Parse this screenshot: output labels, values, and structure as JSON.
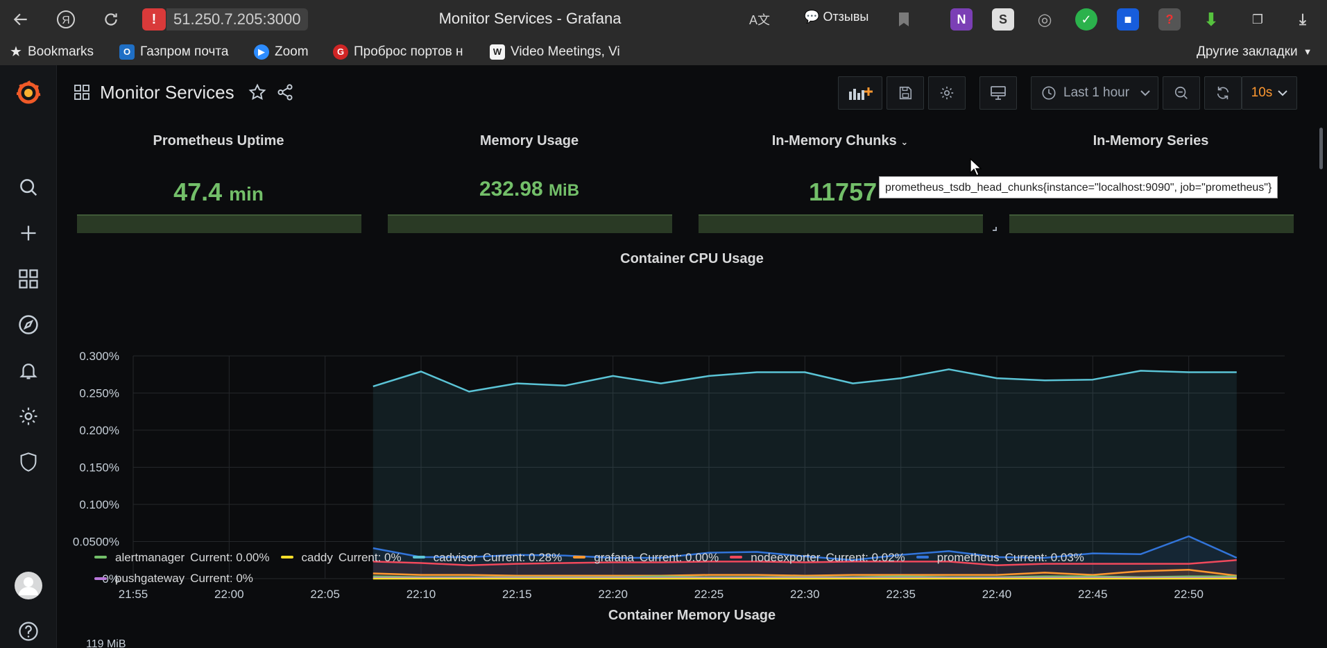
{
  "browser": {
    "address": "51.250.7.205:3000",
    "window_title": "Monitor Services - Grafana",
    "reviews_label": "Отзывы",
    "bookmarks": [
      {
        "label": "Bookmarks",
        "icon": "star-icon"
      },
      {
        "label": "Газпром почта",
        "icon": "outlook-icon"
      },
      {
        "label": "Zoom",
        "icon": "zoom-icon"
      },
      {
        "label": "Проброс портов н",
        "icon": "port-forward-icon"
      },
      {
        "label": "Video Meetings, Vi",
        "icon": "wikipedia-icon"
      }
    ],
    "other_bookmarks": "Другие закладки"
  },
  "dashboard": {
    "title": "Monitor Services",
    "time_range": "Last 1 hour",
    "refresh": "10s"
  },
  "stats": [
    {
      "title": "Prometheus Uptime",
      "value": "47.4",
      "unit": "min"
    },
    {
      "title": "Memory Usage",
      "value": "232.98",
      "unit": "MiB"
    },
    {
      "title": "In-Memory Chunks",
      "value": "11757",
      "unit": ""
    },
    {
      "title": "In-Memory Series",
      "value": "",
      "unit": ""
    }
  ],
  "tooltip": "prometheus_tsdb_head_chunks{instance=\"localhost:9090\", job=\"prometheus\"}",
  "cpu_panel": {
    "title": "Container CPU Usage"
  },
  "memory_panel": {
    "title": "Container Memory Usage",
    "first_tick": "119 MiB"
  },
  "legend": [
    {
      "name": "alertmanager",
      "current": "Current: 0.00%",
      "color": "#73bf69"
    },
    {
      "name": "caddy",
      "current": "Current: 0%",
      "color": "#fade2a"
    },
    {
      "name": "cadvisor",
      "current": "Current: 0.28%",
      "color": "#5bc4d6"
    },
    {
      "name": "grafana",
      "current": "Current: 0.00%",
      "color": "#ff9830"
    },
    {
      "name": "nodeexporter",
      "current": "Current: 0.02%",
      "color": "#f2495c"
    },
    {
      "name": "prometheus",
      "current": "Current: 0.03%",
      "color": "#3274d9"
    },
    {
      "name": "pushgateway",
      "current": "Current: 0%",
      "color": "#b877d9"
    }
  ],
  "chart_data": {
    "type": "line",
    "title": "Container CPU Usage",
    "ylim": [
      0,
      0.3
    ],
    "y_ticks": [
      "0%",
      "0.0500%",
      "0.100%",
      "0.150%",
      "0.200%",
      "0.250%",
      "0.300%"
    ],
    "x_ticks": [
      "21:55",
      "22:00",
      "22:05",
      "22:10",
      "22:15",
      "22:20",
      "22:25",
      "22:30",
      "22:35",
      "22:40",
      "22:45",
      "22:50"
    ],
    "x_range": [
      "21:55",
      "22:55"
    ],
    "x": [
      "22:07:30",
      "22:10",
      "22:12:30",
      "22:15",
      "22:17:30",
      "22:20",
      "22:22:30",
      "22:25",
      "22:27:30",
      "22:30",
      "22:32:30",
      "22:35",
      "22:37:30",
      "22:40",
      "22:42:30",
      "22:45",
      "22:47:30",
      "22:50",
      "22:52:30"
    ],
    "grid": true,
    "series": [
      {
        "name": "cadvisor",
        "color": "#5bc4d6",
        "fill": true,
        "values": [
          0.259,
          0.279,
          0.252,
          0.263,
          0.26,
          0.273,
          0.263,
          0.273,
          0.278,
          0.278,
          0.263,
          0.27,
          0.282,
          0.27,
          0.267,
          0.268,
          0.28,
          0.278,
          0.278
        ]
      },
      {
        "name": "prometheus",
        "color": "#3274d9",
        "values": [
          0.041,
          0.029,
          0.029,
          0.032,
          0.031,
          0.028,
          0.028,
          0.035,
          0.036,
          0.03,
          0.025,
          0.032,
          0.037,
          0.029,
          0.028,
          0.034,
          0.033,
          0.057,
          0.028
        ]
      },
      {
        "name": "nodeexporter",
        "color": "#f2495c",
        "values": [
          0.023,
          0.021,
          0.018,
          0.02,
          0.021,
          0.022,
          0.022,
          0.023,
          0.023,
          0.022,
          0.023,
          0.023,
          0.023,
          0.018,
          0.02,
          0.02,
          0.02,
          0.02,
          0.025
        ]
      },
      {
        "name": "grafana",
        "color": "#ff9830",
        "values": [
          0.007,
          0.005,
          0.005,
          0.004,
          0.004,
          0.004,
          0.004,
          0.005,
          0.005,
          0.004,
          0.005,
          0.005,
          0.005,
          0.005,
          0.008,
          0.005,
          0.01,
          0.012,
          0.004
        ]
      },
      {
        "name": "alertmanager",
        "color": "#73bf69",
        "values": [
          0.003,
          0.002,
          0.002,
          0.002,
          0.002,
          0.002,
          0.003,
          0.002,
          0.002,
          0.002,
          0.002,
          0.003,
          0.002,
          0.002,
          0.003,
          0.003,
          0.002,
          0.003,
          0.003
        ]
      },
      {
        "name": "pushgateway",
        "color": "#b877d9",
        "values": [
          0.001,
          0.001,
          0.001,
          0.001,
          0.001,
          0.001,
          0.001,
          0.001,
          0.001,
          0.001,
          0.001,
          0.001,
          0.001,
          0.001,
          0.001,
          0.001,
          0.001,
          0.001,
          0.001
        ]
      },
      {
        "name": "caddy",
        "color": "#fade2a",
        "values": [
          0.0,
          0.0,
          0.0,
          0.0,
          0.0,
          0.0,
          0.0,
          0.0,
          0.0,
          0.0,
          0.0,
          0.0,
          0.0,
          0.0,
          0.0,
          0.0,
          0.0,
          0.0,
          0.0
        ]
      }
    ]
  }
}
